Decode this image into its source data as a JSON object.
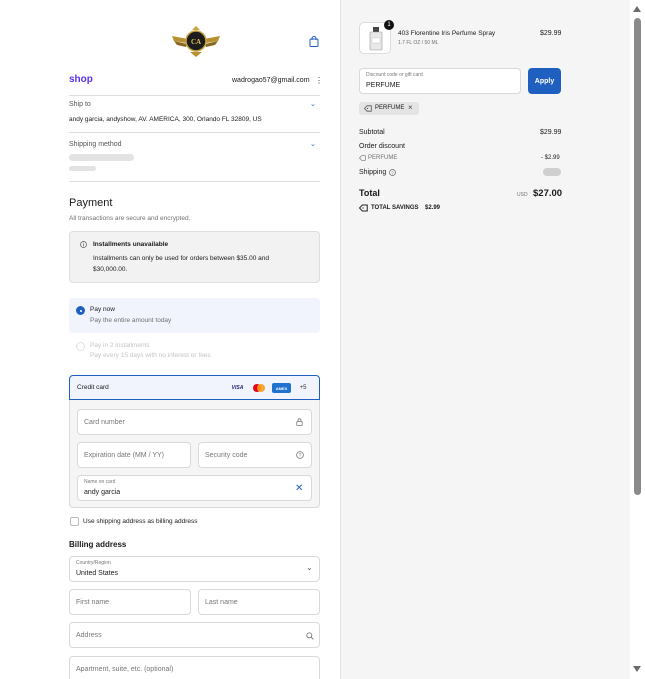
{
  "header": {
    "logo_text": "CA",
    "wallet_brand": "shop",
    "email": "wadrogao57@gmail.com"
  },
  "ship_to": {
    "label": "Ship to",
    "address": "andy garcia, andyshow, AV. AMERICA, 300, Orlando FL 32809, US"
  },
  "shipping_method": {
    "label": "Shipping method"
  },
  "payment": {
    "title": "Payment",
    "subtitle": "All transactions are secure and encrypted.",
    "installments_title": "Installments unavailable",
    "installments_text_1": "Installments can only be used for orders between $35.00 and",
    "installments_text_2": "$30,000.00.",
    "pay_now_title": "Pay now",
    "pay_now_sub": "Pay the entire amount today",
    "pay_in_2_title": "Pay in 2 installments",
    "pay_in_2_sub": "Pay every 15 days with no interest or fees",
    "credit_card_label": "Credit card",
    "card_brands": [
      "VISA",
      "MC",
      "AMEX",
      "+5"
    ],
    "card_number_placeholder": "Card number",
    "expiration_placeholder": "Expiration date (MM / YY)",
    "security_placeholder": "Security code",
    "name_on_card_label": "Name on card",
    "name_on_card_value": "andy garcia",
    "use_shipping_label": "Use shipping address as billing address"
  },
  "billing": {
    "title": "Billing address",
    "country_label": "Country/Region",
    "country_value": "United States",
    "first_name_placeholder": "First name",
    "last_name_placeholder": "Last name",
    "address_placeholder": "Address",
    "apartment_placeholder": "Apartment, suite, etc. (optional)"
  },
  "order": {
    "item_qty": "1",
    "item_name": "403  Florentine Iris Perfume Spray",
    "item_variant": "1.7 FL OZ / 50 ML",
    "item_price": "$29.99",
    "discount_label": "Discount code or gift card",
    "discount_value": "PERFUME",
    "apply_label": "Apply",
    "applied_tag": "PERFUME",
    "subtotal_label": "Subtotal",
    "subtotal_value": "$29.99",
    "order_discount_label": "Order discount",
    "discount_code_label": "PERFUME",
    "discount_amount": "- $2.99",
    "shipping_label": "Shipping",
    "total_label": "Total",
    "total_currency": "USD",
    "total_value": "$27.00",
    "savings_label": "TOTAL SAVINGS",
    "savings_value": "$2.99"
  },
  "colors": {
    "accent": "#1f5fbf",
    "shop_brand": "#5a31f4"
  }
}
